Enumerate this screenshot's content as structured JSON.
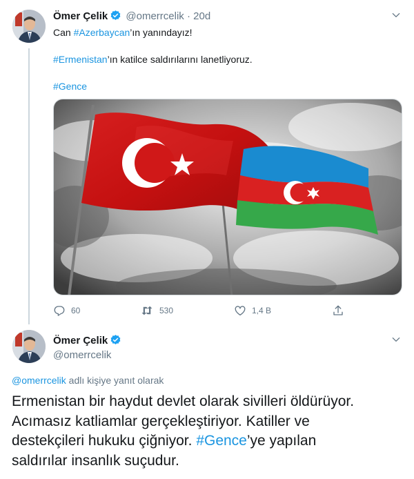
{
  "tweet1": {
    "author_name": "Ömer Çelik",
    "author_handle": "@omerrcelik",
    "separator": "·",
    "time": "20d",
    "line1": {
      "prefix": "Can ",
      "hashtag": "#Azerbaycan",
      "suffix": "’ın yanındayız!"
    },
    "line2": {
      "hashtag": "#Ermenistan",
      "suffix": "’ın katilce saldırılarını lanetliyoruz."
    },
    "line3": {
      "hashtag": "#Gence"
    },
    "media": {
      "description_icon": "turkey-azerbaijan-flags-photo"
    },
    "actions": {
      "reply_count": "60",
      "retweet_count": "530",
      "like_count": "1,4 B"
    }
  },
  "tweet2": {
    "author_name": "Ömer Çelik",
    "author_handle": "@omerrcelik",
    "reply_to": {
      "mention": "@omerrcelik",
      "suffix": " adlı kişiye yanıt olarak"
    },
    "text": {
      "line1": "Ermenistan bir haydut devlet olarak sivilleri öldürüyor.",
      "line2": "Acımasız katliamlar gerçekleştiriyor. Katiller ve",
      "line3_prefix": "destekçileri hukuku çiğniyor. ",
      "line3_hashtag": "#Gence",
      "line3_suffix": "’ye yapılan",
      "line4": "saldırılar insanlık suçudur."
    }
  },
  "colors": {
    "link": "#1b95e0",
    "secondary_text": "#657786",
    "primary_text": "#14171a",
    "verified": "#1da1f2"
  }
}
